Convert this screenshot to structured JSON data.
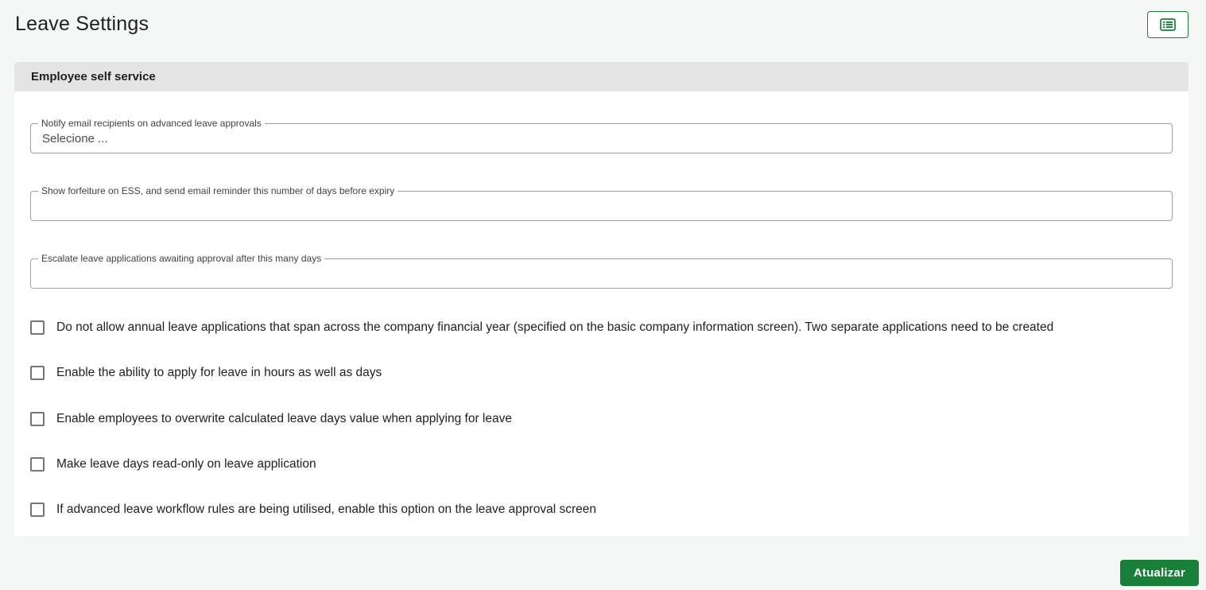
{
  "header": {
    "title": "Leave Settings",
    "toolbar_icon": "list-alt-icon"
  },
  "section": {
    "title": "Employee self service",
    "fields": [
      {
        "label": "Notify email recipients on advanced leave approvals",
        "value": "Selecione ...",
        "type": "select"
      },
      {
        "label": "Show forfeiture on ESS, and send email reminder this number of days before expiry",
        "value": "",
        "type": "text"
      },
      {
        "label": "Escalate leave applications awaiting approval after this many days",
        "value": "",
        "type": "text"
      }
    ],
    "checkboxes": [
      {
        "label": "Do not allow annual leave applications that span across the company financial year (specified on the basic company information screen). Two separate applications need to be created",
        "checked": false
      },
      {
        "label": "Enable the ability to apply for leave in hours as well as days",
        "checked": false
      },
      {
        "label": "Enable employees to overwrite calculated leave days value when applying for leave",
        "checked": false
      },
      {
        "label": "Make leave days read-only on leave application",
        "checked": false
      },
      {
        "label": "If advanced leave workflow rules are being utilised, enable this option on the leave approval screen",
        "checked": false
      }
    ]
  },
  "footer": {
    "update_label": "Atualizar"
  },
  "colors": {
    "accent_green": "#188038",
    "section_header_bg": "#e4e4e4",
    "page_bg": "#f5f6f6",
    "field_border": "#9e9e9e"
  }
}
